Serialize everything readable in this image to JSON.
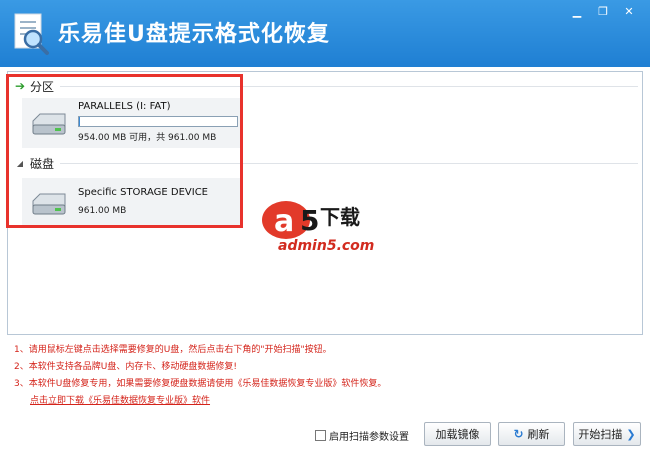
{
  "window": {
    "title": "乐易佳U盘提示格式化恢复",
    "controls": {
      "minimize": "▁",
      "restore": "❐",
      "close": "✕"
    }
  },
  "sections": [
    {
      "label": "分区",
      "icon": "green-arrow-icon",
      "items": [
        {
          "name": "PARALLELS (I: FAT)",
          "detail": "954.00 MB 可用，共 961.00 MB",
          "usage_fraction": 0.008
        }
      ]
    },
    {
      "label": "磁盘",
      "icon": "collapse-triangle-icon",
      "items": [
        {
          "name": "Specific STORAGE DEVICE",
          "detail": "961.00 MB"
        }
      ]
    }
  ],
  "watermark": {
    "brand": "a",
    "brand_num": "5",
    "text": "下载",
    "url": "admin5.com"
  },
  "notes": [
    "1、请用鼠标左键点击选择需要修复的U盘，然后点击右下角的\"开始扫描\"按钮。",
    "2、本软件支持各品牌U盘、内存卡、移动硬盘数据修复!",
    "3、本软件U盘修复专用，如果需要修复硬盘数据请使用《乐易佳数据恢复专业版》软件恢复。"
  ],
  "download_link": "点击立即下载《乐易佳数据恢复专业版》软件",
  "footer": {
    "scan_settings_label": "启用扫描参数设置",
    "scan_settings_checked": false,
    "load_image_label": "加载镜像",
    "refresh_label": "刷新",
    "start_scan_label": "开始扫描"
  },
  "colors": {
    "titlebar": "#2b8ee0",
    "accent": "#2a7bd2",
    "highlight_box": "#e8322c",
    "note_text": "#d4231a"
  }
}
